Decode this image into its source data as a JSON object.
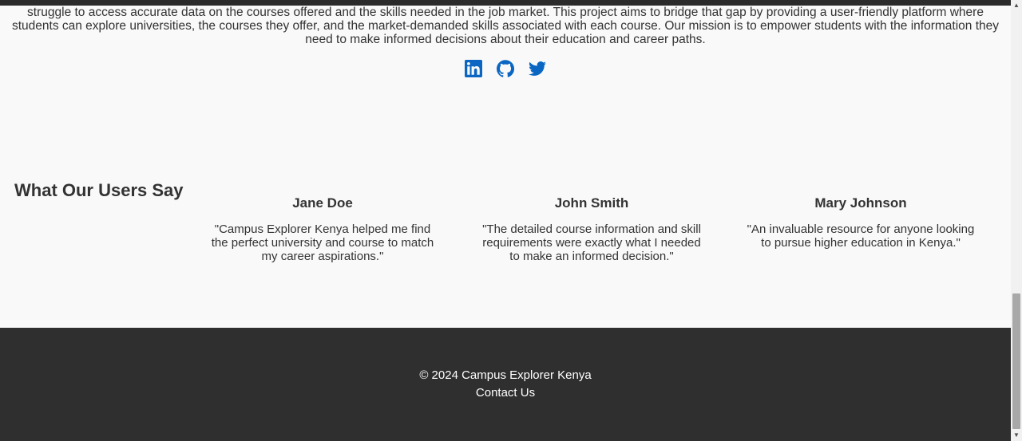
{
  "about": {
    "paragraph": "struggle to access accurate data on the courses offered and the skills needed in the job market. This project aims to bridge that gap by providing a user-friendly platform where students can explore universities, the courses they offer, and the market-demanded skills associated with each course. Our mission is to empower students with the information they need to make informed decisions about their education and career paths."
  },
  "socials": {
    "icons": [
      "linkedin-icon",
      "github-icon",
      "twitter-icon"
    ],
    "color": "#0a66c2"
  },
  "testimonials": {
    "title": "What Our Users Say",
    "items": [
      {
        "name": "Jane Doe",
        "quote": "\"Campus Explorer Kenya helped me find the perfect university and course to match my career aspirations.\""
      },
      {
        "name": "John Smith",
        "quote": "\"The detailed course information and skill requirements were exactly what I needed to make an informed decision.\""
      },
      {
        "name": "Mary Johnson",
        "quote": "\"An invaluable resource for anyone looking to pursue higher education in Kenya.\""
      }
    ]
  },
  "footer": {
    "copyright": "© 2024 Campus Explorer Kenya",
    "contact_label": "Contact Us",
    "background": "#2f2f2f"
  }
}
